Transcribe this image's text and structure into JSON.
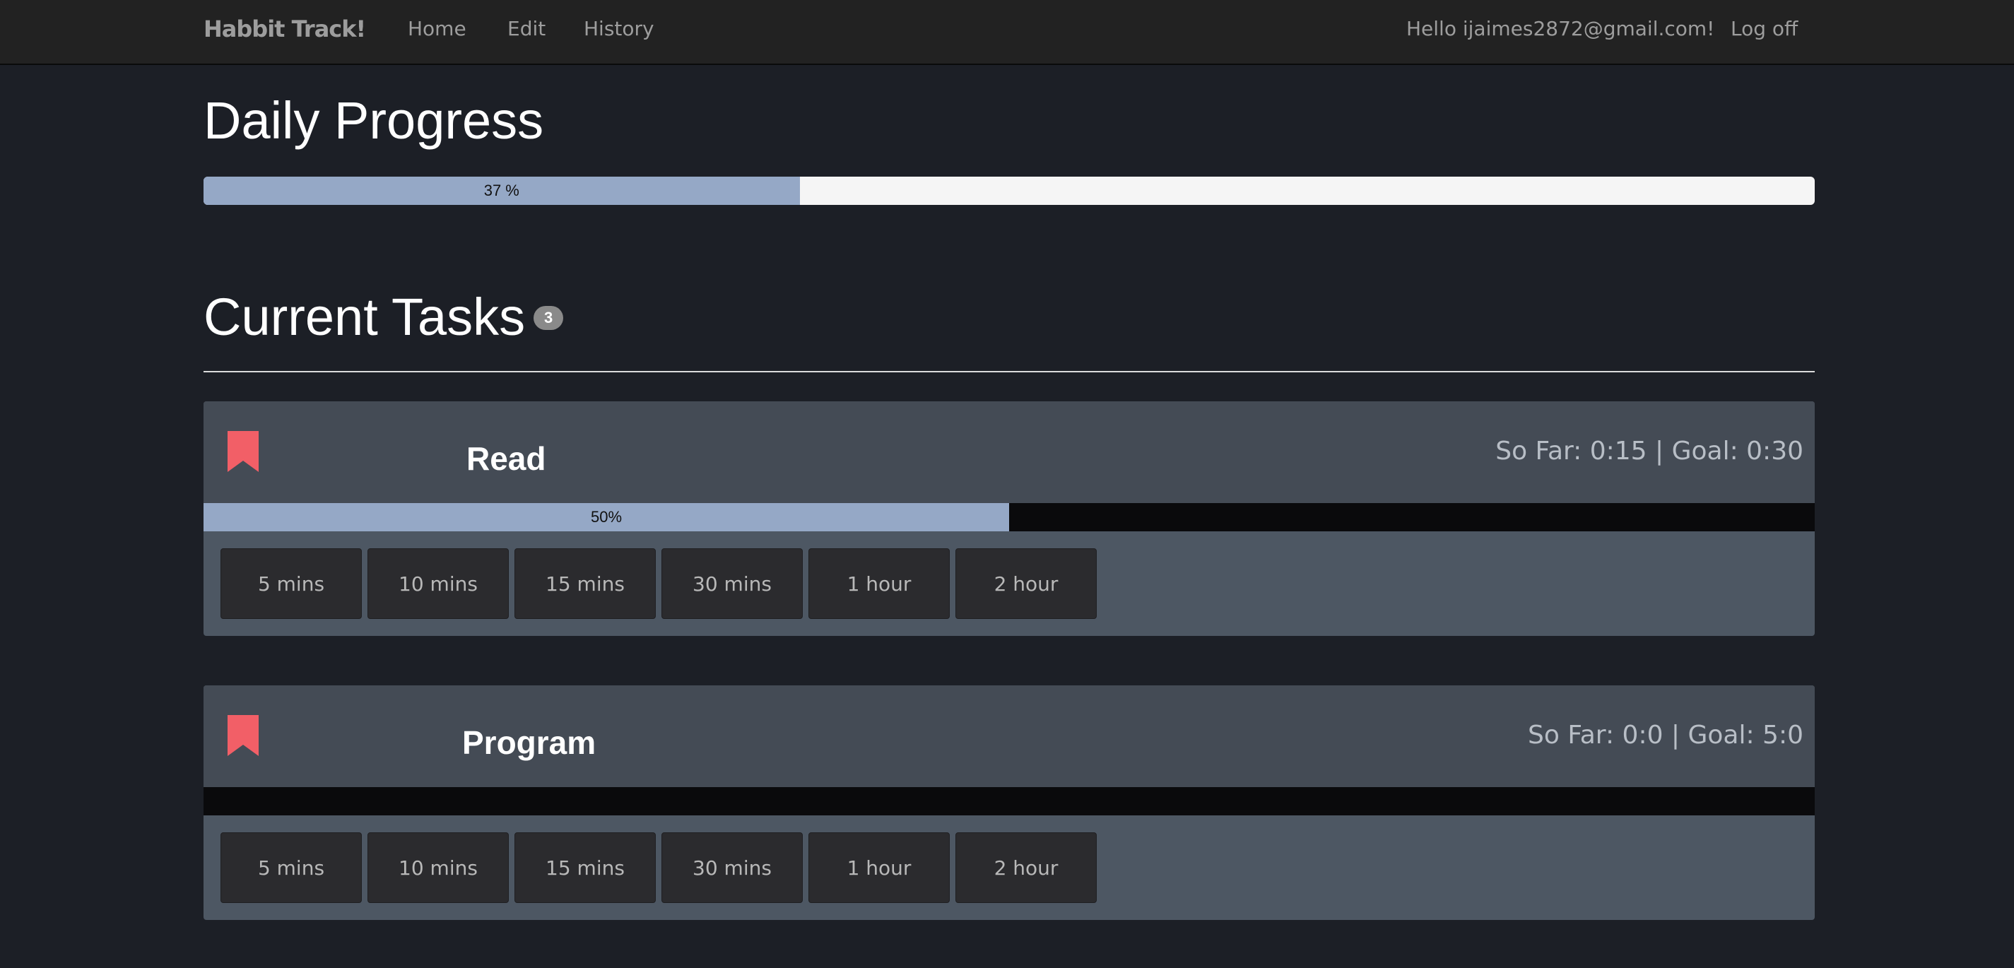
{
  "navbar": {
    "brand": "Habbit Track!",
    "links": [
      "Home",
      "Edit",
      "History"
    ],
    "greeting": "Hello ijaimes2872@gmail.com!",
    "logoff": "Log off"
  },
  "daily": {
    "title": "Daily Progress",
    "progress_value": 37,
    "progress_label": "37 %"
  },
  "tasks_section": {
    "title": "Current Tasks",
    "count": "3"
  },
  "tasks": [
    {
      "name": "Read",
      "stats": "So Far: 0:15 | Goal: 0:30",
      "progress_value": 50,
      "progress_label": "50%",
      "buttons": [
        "5 mins",
        "10 mins",
        "15 mins",
        "30 mins",
        "1 hour",
        "2 hour"
      ]
    },
    {
      "name": "Program",
      "stats": "So Far: 0:0 | Goal: 5:0",
      "progress_value": 0,
      "progress_label": "",
      "buttons": [
        "5 mins",
        "10 mins",
        "15 mins",
        "30 mins",
        "1 hour",
        "2 hour"
      ]
    }
  ],
  "colors": {
    "background": "#1c1f26",
    "navbar": "#222222",
    "progress_fill": "#95a8c6",
    "bookmark": "#f25f67",
    "card_header": "#444b55",
    "card_body": "#4d5763"
  },
  "icons": {
    "task_icon": "bookmark-icon"
  }
}
